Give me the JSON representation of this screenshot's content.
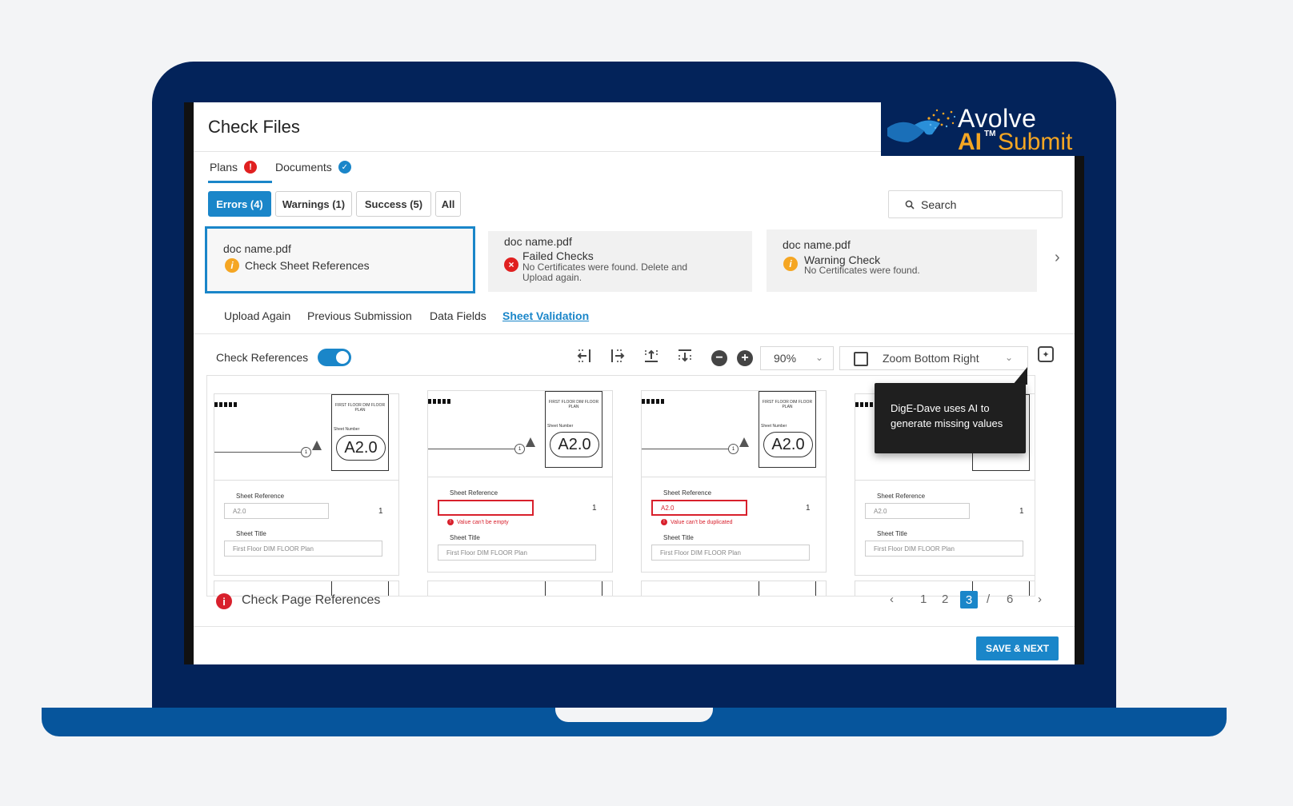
{
  "brand": {
    "line1": "Avolve",
    "ai": "AI",
    "tm": "TM",
    "submit": "Submit"
  },
  "page": {
    "title": "Check Files"
  },
  "tabs": [
    {
      "label": "Plans",
      "badge": "!"
    },
    {
      "label": "Documents",
      "badge": "✓"
    }
  ],
  "filters": [
    {
      "label": "Errors (4)"
    },
    {
      "label": "Warnings (1)"
    },
    {
      "label": "Success (5)"
    },
    {
      "label": "All"
    }
  ],
  "search": {
    "label": "Search"
  },
  "doc_cards": [
    {
      "name": "doc name.pdf",
      "status": "Check Sheet References",
      "detail": ""
    },
    {
      "name": "doc name.pdf",
      "status": "Failed Checks",
      "detail": "No Certificates were found. Delete and Upload again."
    },
    {
      "name": "doc name.pdf",
      "status": "Warning Check",
      "detail": "No Certificates were found."
    }
  ],
  "subtabs": [
    {
      "label": "Upload Again"
    },
    {
      "label": "Previous Submission"
    },
    {
      "label": "Data Fields"
    },
    {
      "label": "Sheet Validation"
    }
  ],
  "toolbar": {
    "check_references_label": "Check References",
    "check_references_on": true,
    "zoom_level": "90%",
    "zoom_mode": "Zoom Bottom Right"
  },
  "sheets": [
    {
      "head": "FIRST FLOOR DIM FLOOR PLAN",
      "sheet_number_label": "Sheet Number",
      "number": "A2.0",
      "ref_label": "Sheet Reference",
      "ref_value": "A2.0",
      "count": "1",
      "title_label": "Sheet Title",
      "title_value": "First Floor DIM FLOOR Plan",
      "error": ""
    },
    {
      "head": "FIRST FLOOR DIM FLOOR PLAN",
      "sheet_number_label": "Sheet Number",
      "number": "A2.0",
      "ref_label": "Sheet Reference",
      "ref_value": "",
      "count": "1",
      "title_label": "Sheet Title",
      "title_value": "First Floor DIM FLOOR Plan",
      "error": "Value can't be empty"
    },
    {
      "head": "FIRST FLOOR DIM FLOOR PLAN",
      "sheet_number_label": "Sheet Number",
      "number": "A2.0",
      "ref_label": "Sheet Reference",
      "ref_value": "A2.0",
      "count": "1",
      "title_label": "Sheet Title",
      "title_value": "First Floor DIM FLOOR Plan",
      "error": "Value can't be duplicated"
    },
    {
      "head": "",
      "sheet_number_label": "",
      "number": "",
      "ref_label": "Sheet Reference",
      "ref_value": "A2.0",
      "count": "1",
      "title_label": "Sheet Title",
      "title_value": "First Floor DIM FLOOR Plan",
      "error": ""
    }
  ],
  "tooltip": {
    "text": "DigE-Dave uses AI to generate missing values"
  },
  "footer": {
    "status_text": "Check Page References",
    "pages": [
      "1",
      "2",
      "3"
    ],
    "current_page": "3",
    "separator": "/",
    "total_pages": "6",
    "save_label": "SAVE & NEXT"
  },
  "colors": {
    "accent": "#1a86c9",
    "error": "#d8202c",
    "warning": "#f5a623",
    "frame": "#03235a"
  }
}
